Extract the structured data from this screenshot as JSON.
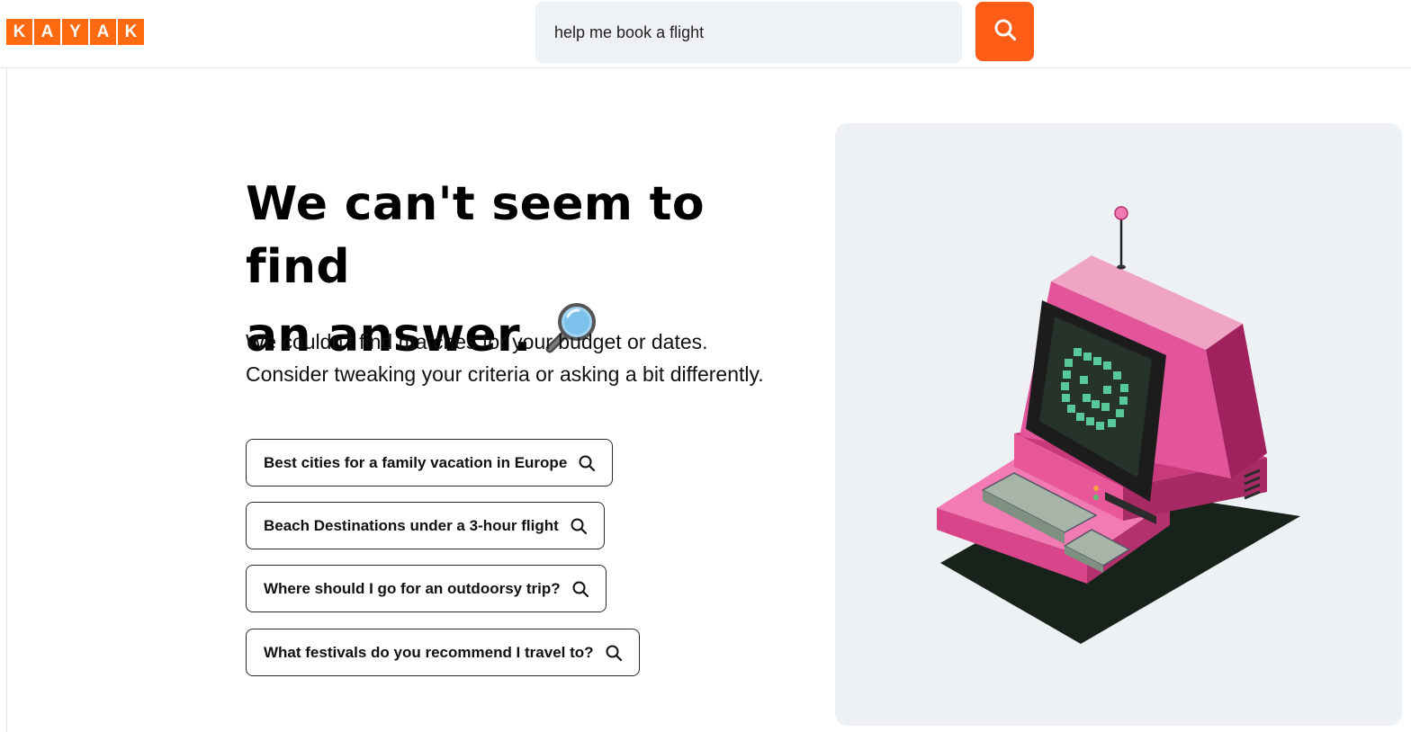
{
  "header": {
    "logo_letters": [
      "K",
      "A",
      "Y",
      "A",
      "K"
    ],
    "search_value": "help me book a flight",
    "search_button_icon": "search-icon",
    "brand_color": "#ff690f",
    "accent_color": "#ff5c18"
  },
  "main": {
    "headline_line1": "We can't seem to find",
    "headline_line2": "an answer.",
    "headline_icon": "magnifying-glass-icon",
    "description_line1": "We couldn’t find matches for your budget or dates.",
    "description_line2": "Consider tweaking your criteria or asking a bit differently.",
    "suggestions": [
      {
        "label": "Best cities for a family vacation in Europe",
        "icon": "search-icon"
      },
      {
        "label": "Beach Destinations under a 3-hour flight",
        "icon": "search-icon"
      },
      {
        "label": "Where should I go for an outdoorsy trip?",
        "icon": "search-icon"
      },
      {
        "label": "What festivals do you recommend I travel to?",
        "icon": "search-icon"
      }
    ]
  },
  "illustration": {
    "subject": "retro-computer-illustration",
    "colors": {
      "body": "#e8579a",
      "screen_face": "#57c99a",
      "panel_bg": "#eef1f4"
    }
  }
}
